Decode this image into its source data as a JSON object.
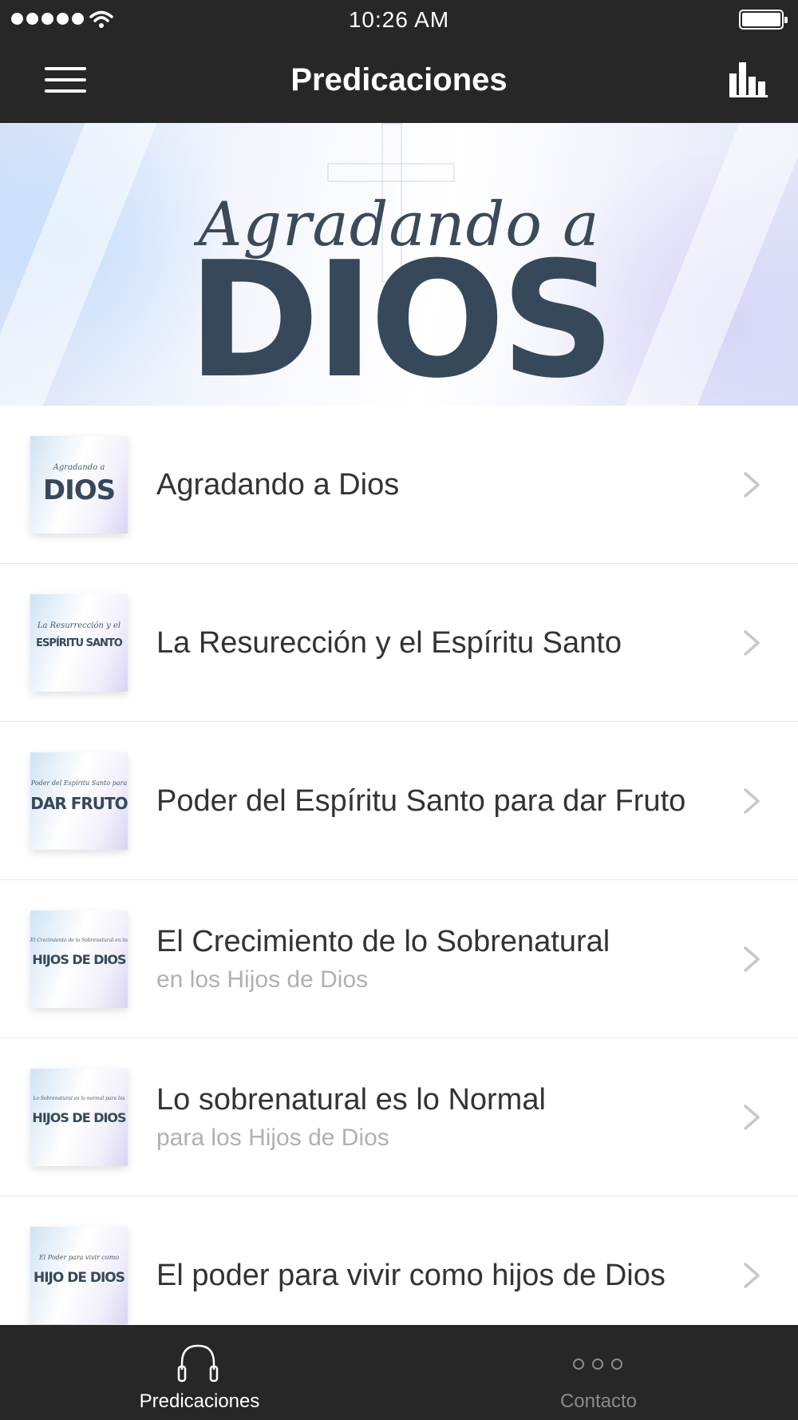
{
  "status_bar": {
    "time": "10:26 AM",
    "signal_icon": "signal-dots-icon",
    "wifi_icon": "wifi-icon",
    "battery_icon": "battery-icon"
  },
  "nav": {
    "title": "Predicaciones",
    "menu_icon": "hamburger-menu-icon",
    "stats_icon": "bar-chart-icon"
  },
  "banner": {
    "script_text": "Agradando a",
    "big_text": "DIOS"
  },
  "list": [
    {
      "title": "Agradando a Dios",
      "subtitle": "",
      "thumb_script": "Agradando a",
      "thumb_big": "DIOS"
    },
    {
      "title": "La Resurección y el Espíritu Santo",
      "subtitle": "",
      "thumb_script": "La Resurrección y el",
      "thumb_big": "ESPÍRITU SANTO"
    },
    {
      "title": "Poder del Espíritu Santo para dar Fruto",
      "subtitle": "",
      "thumb_script": "Poder del Espíritu Santo para",
      "thumb_big": "DAR FRUTO"
    },
    {
      "title": "El Crecimiento de lo Sobrenatural",
      "subtitle": "en los Hijos de Dios",
      "thumb_script": "El Crecimiento de lo Sobrenatural en los",
      "thumb_big": "HIJOS DE DIOS"
    },
    {
      "title": "Lo sobrenatural es lo Normal",
      "subtitle": "para los Hijos de Dios",
      "thumb_script": "Lo Sobrenatural es lo normal para los",
      "thumb_big": "HIJOS DE DIOS"
    },
    {
      "title": "El poder para vivir como hijos de Dios",
      "subtitle": "",
      "thumb_script": "El Poder para vivir como",
      "thumb_big": "HIJO DE DIOS"
    }
  ],
  "tabs": [
    {
      "label": "Predicaciones",
      "icon": "headphones-icon",
      "active": true,
      "color": "#ffffff"
    },
    {
      "label": "Contacto",
      "icon": "more-dots-icon",
      "active": false,
      "color": "#8a8a8a"
    }
  ],
  "colors": {
    "bar_background": "#272727",
    "title_text": "#333333",
    "subtitle_text": "#b0b0b0",
    "chevron": "#c7c7cc",
    "banner_text": "#36485a"
  }
}
